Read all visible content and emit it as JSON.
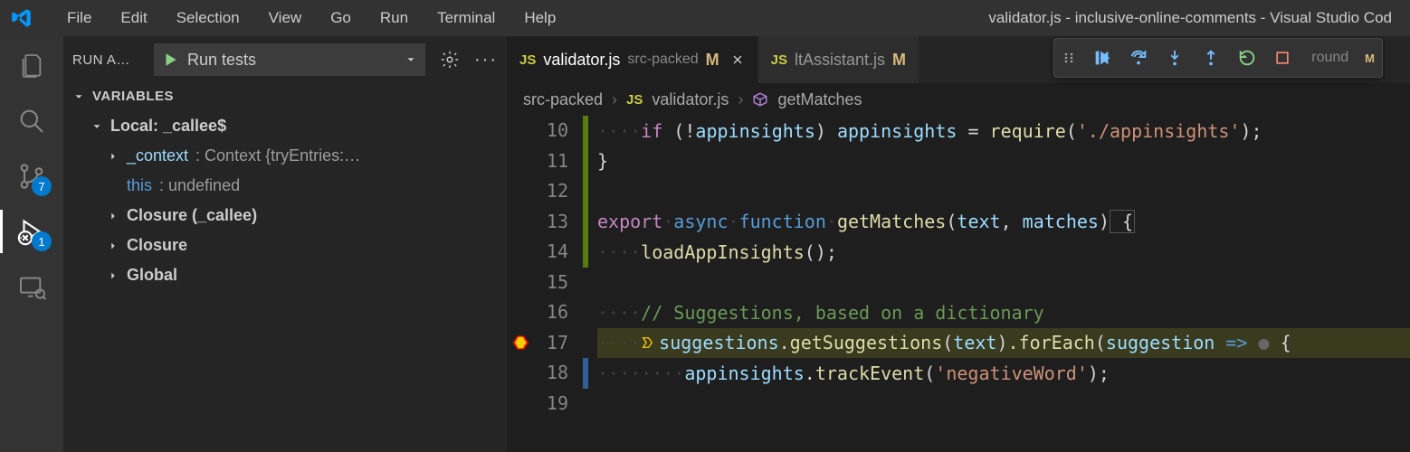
{
  "window": {
    "title": "validator.js - inclusive-online-comments - Visual Studio Cod"
  },
  "menu": [
    "File",
    "Edit",
    "Selection",
    "View",
    "Go",
    "Run",
    "Terminal",
    "Help"
  ],
  "activity": {
    "scm_badge": "7",
    "debug_badge": "1"
  },
  "sidebar": {
    "title": "RUN A…",
    "config": "Run tests",
    "section_variables": "VARIABLES",
    "scopes": {
      "local_label": "Local: _callee$",
      "context_name": "_context",
      "context_value": ": Context {tryEntries:…",
      "this_name": "this",
      "this_value": ": undefined",
      "closure_callee": "Closure (_callee)",
      "closure": "Closure",
      "global": "Global"
    }
  },
  "tabs": [
    {
      "file": "validator.js",
      "dir": "src-packed",
      "mod": "M",
      "active": true,
      "close": true
    },
    {
      "file": "ltAssistant.js",
      "dir": "",
      "mod": "M",
      "active": false,
      "close": false
    },
    {
      "file_suffix": "round",
      "mod": "M"
    }
  ],
  "breadcrumb": {
    "folder": "src-packed",
    "file": "validator.js",
    "symbol": "getMatches"
  },
  "code": {
    "lines": [
      {
        "no": 10,
        "glyph": "green"
      },
      {
        "no": 11,
        "glyph": "green"
      },
      {
        "no": 12,
        "glyph": "green"
      },
      {
        "no": 13,
        "glyph": "green"
      },
      {
        "no": 14,
        "glyph": "green"
      },
      {
        "no": 15,
        "glyph": ""
      },
      {
        "no": 16,
        "glyph": ""
      },
      {
        "no": 17,
        "glyph": "",
        "bp": true,
        "exec": true
      },
      {
        "no": 18,
        "glyph": "blue"
      },
      {
        "no": 19,
        "glyph": ""
      }
    ],
    "t": {
      "l10": {
        "if": "if",
        "not": "!",
        "app1": "appinsights",
        "p1": ")",
        "sp": " ",
        "app2": "appinsights",
        "eq": " = ",
        "req": "require",
        "po": "(",
        "str": "'./appinsights'",
        "pc": ");"
      },
      "l11": {
        "brace": "}"
      },
      "l13": {
        "export": "export",
        "async": "async",
        "function": "function",
        "name": "getMatches",
        "po": "(",
        "a1": "text",
        "c": ", ",
        "a2": "matches",
        "pc": ")",
        "brace": " {"
      },
      "l14": {
        "fn": "loadAppInsights",
        "call": "();"
      },
      "l16": {
        "comment": "// Suggestions, based on a dictionary"
      },
      "l17": {
        "sug": "suggestions",
        "dot1": ".",
        "get": "getSuggestions",
        "po": "(",
        "txt": "text",
        "pc": ").",
        "fe": "forEach",
        "po2": "(",
        "arg": "suggestion",
        "arrow": " =>",
        "hint": " ●",
        "brace": " {"
      },
      "l18": {
        "app": "appinsights",
        "dot": ".",
        "te": "trackEvent",
        "po": "(",
        "str": "'negativeWord'",
        "pc": ");"
      }
    }
  }
}
